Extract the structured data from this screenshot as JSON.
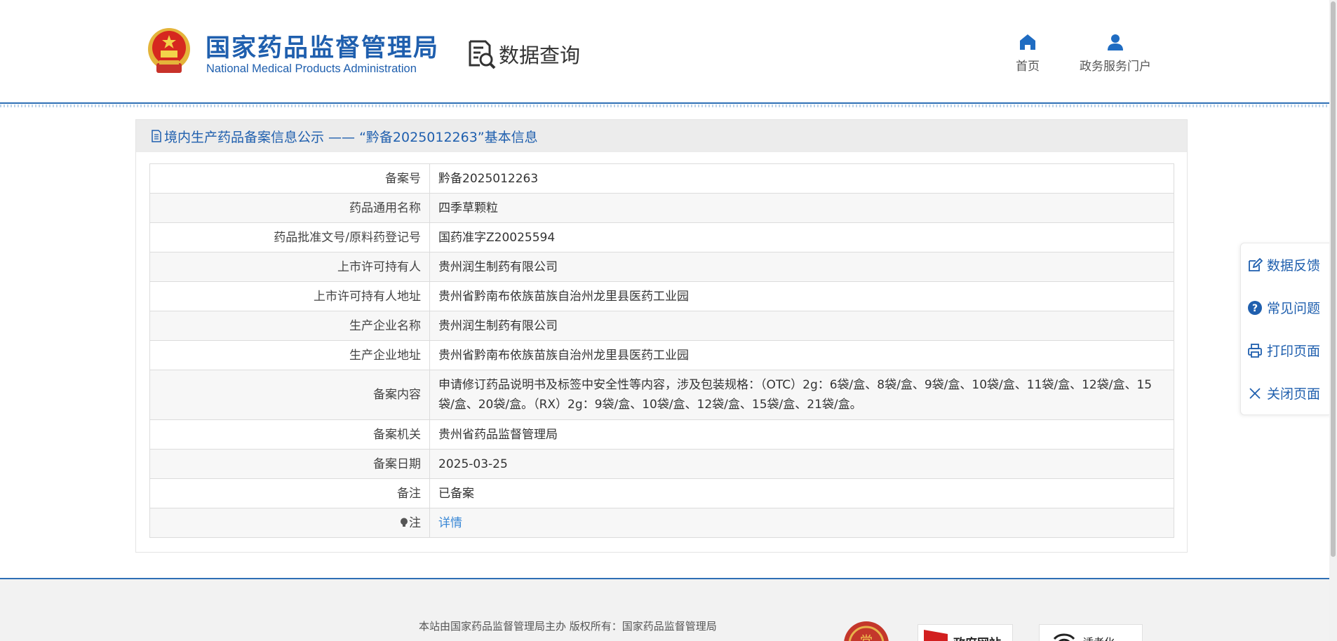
{
  "header": {
    "logo_cn": "国家药品监督管理局",
    "logo_en": "National Medical Products Administration",
    "query_label": "数据查询",
    "nav": {
      "home_label": "首页",
      "portal_label": "政务服务门户"
    }
  },
  "panel": {
    "title": "境内生产药品备案信息公示 —— “黔备2025012263”基本信息"
  },
  "record": {
    "rows": [
      {
        "label": "备案号",
        "value": "黔备2025012263"
      },
      {
        "label": "药品通用名称",
        "value": "四季草颗粒"
      },
      {
        "label": "药品批准文号/原料药登记号",
        "value": "国药准字Z20025594"
      },
      {
        "label": "上市许可持有人",
        "value": "贵州润生制药有限公司"
      },
      {
        "label": "上市许可持有人地址",
        "value": "贵州省黔南布依族苗族自治州龙里县医药工业园"
      },
      {
        "label": "生产企业名称",
        "value": "贵州润生制药有限公司"
      },
      {
        "label": "生产企业地址",
        "value": "贵州省黔南布依族苗族自治州龙里县医药工业园"
      },
      {
        "label": "备案内容",
        "value": "申请修订药品说明书及标签中安全性等内容，涉及包装规格：（OTC）2g：6袋/盒、8袋/盒、9袋/盒、10袋/盒、11袋/盒、12袋/盒、15袋/盒、20袋/盒。（RX）2g：9袋/盒、10袋/盒、12袋/盒、15袋/盒、21袋/盒。"
      },
      {
        "label": "备案机关",
        "value": "贵州省药品监督管理局"
      },
      {
        "label": "备案日期",
        "value": "2025-03-25"
      },
      {
        "label": "备注",
        "value": "已备案"
      },
      {
        "label": "注",
        "value": "详情"
      }
    ]
  },
  "float_bar": {
    "feedback": "数据反馈",
    "faq": "常见问题",
    "print": "打印页面",
    "close": "关闭页面"
  },
  "footer": {
    "text": "本站由国家药品监督管理局主办 版权所有：国家药品监督管理局",
    "gov_badge": "政府网站",
    "aging_badge": "适老化"
  },
  "colors": {
    "brand_blue": "#1f5fae",
    "link_blue": "#3a88d6",
    "header_border": "#2d6fb5"
  }
}
